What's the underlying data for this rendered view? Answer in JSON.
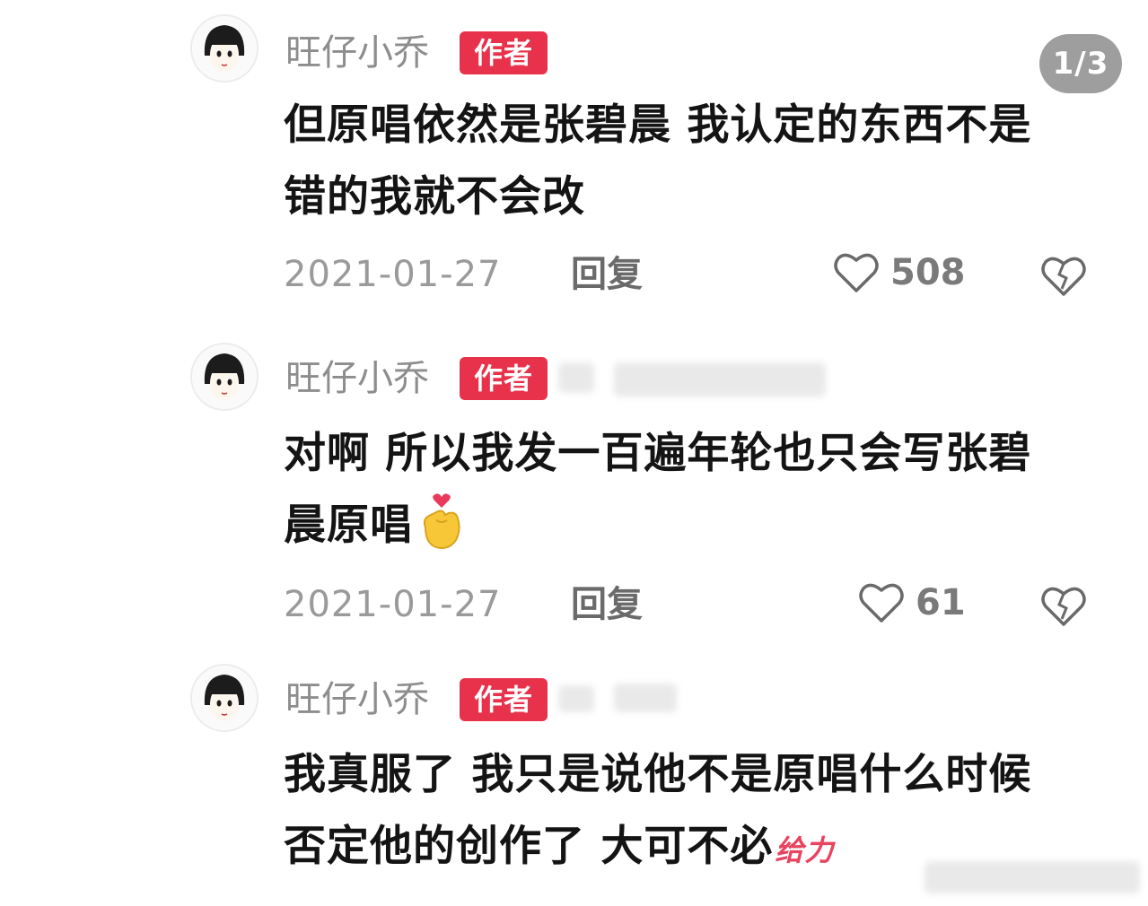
{
  "page_counter": "1/3",
  "comments": [
    {
      "author": "旺仔小乔",
      "badge": "作者",
      "text": "但原唱依然是张碧晨 我认定的东西不是错的我就不会改",
      "date": "2021-01-27",
      "reply_label": "回复",
      "likes": "508"
    },
    {
      "author": "旺仔小乔",
      "badge": "作者",
      "text": "对啊 所以我发一百遍年轮也只会写张碧晨原唱",
      "date": "2021-01-27",
      "reply_label": "回复",
      "likes": "61"
    },
    {
      "author": "旺仔小乔",
      "badge": "作者",
      "text": "我真服了 我只是说他不是原唱什么时候否定他的创作了 大可不必",
      "sticker": "给力"
    }
  ],
  "icons": {
    "like": "heart-outline-icon",
    "dislike": "broken-heart-icon",
    "emoji": "finger-heart-emoji-icon"
  },
  "colors": {
    "badge": "#e8314a",
    "name": "#8d8d8d",
    "counter_bg": "#9e9e9e"
  }
}
